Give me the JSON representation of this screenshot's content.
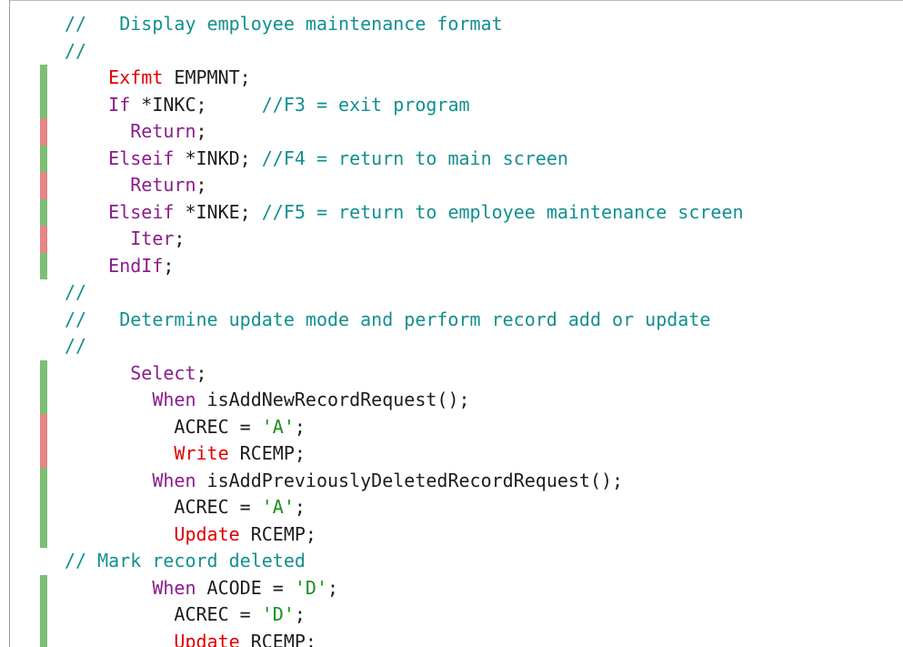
{
  "lines": [
    {
      "marker": "none",
      "tokens": [
        {
          "t": "cm",
          "v": "//   Display employee maintenance format"
        }
      ]
    },
    {
      "marker": "none",
      "tokens": [
        {
          "t": "cm",
          "v": "//"
        }
      ]
    },
    {
      "marker": "green",
      "tokens": [
        {
          "t": "pl",
          "v": "    "
        },
        {
          "t": "op",
          "v": "Exfmt"
        },
        {
          "t": "pl",
          "v": " EMPMNT;"
        }
      ]
    },
    {
      "marker": "green",
      "tokens": [
        {
          "t": "pl",
          "v": "    "
        },
        {
          "t": "kw",
          "v": "If"
        },
        {
          "t": "pl",
          "v": " *INKC;     "
        },
        {
          "t": "cm",
          "v": "//F3 = exit program"
        }
      ]
    },
    {
      "marker": "red",
      "tokens": [
        {
          "t": "pl",
          "v": "      "
        },
        {
          "t": "kw",
          "v": "Return"
        },
        {
          "t": "pl",
          "v": ";"
        }
      ]
    },
    {
      "marker": "green",
      "tokens": [
        {
          "t": "pl",
          "v": "    "
        },
        {
          "t": "kw",
          "v": "Elseif"
        },
        {
          "t": "pl",
          "v": " *INKD; "
        },
        {
          "t": "cm",
          "v": "//F4 = return to main screen"
        }
      ]
    },
    {
      "marker": "red",
      "tokens": [
        {
          "t": "pl",
          "v": "      "
        },
        {
          "t": "kw",
          "v": "Return"
        },
        {
          "t": "pl",
          "v": ";"
        }
      ]
    },
    {
      "marker": "green",
      "tokens": [
        {
          "t": "pl",
          "v": "    "
        },
        {
          "t": "kw",
          "v": "Elseif"
        },
        {
          "t": "pl",
          "v": " *INKE; "
        },
        {
          "t": "cm",
          "v": "//F5 = return to employee maintenance screen"
        }
      ]
    },
    {
      "marker": "red",
      "tokens": [
        {
          "t": "pl",
          "v": "      "
        },
        {
          "t": "kw",
          "v": "Iter"
        },
        {
          "t": "pl",
          "v": ";"
        }
      ]
    },
    {
      "marker": "green",
      "tokens": [
        {
          "t": "pl",
          "v": "    "
        },
        {
          "t": "kw",
          "v": "EndIf"
        },
        {
          "t": "pl",
          "v": ";"
        }
      ]
    },
    {
      "marker": "none",
      "tokens": [
        {
          "t": "cm",
          "v": "//"
        }
      ]
    },
    {
      "marker": "none",
      "tokens": [
        {
          "t": "cm",
          "v": "//   Determine update mode and perform record add or update"
        }
      ]
    },
    {
      "marker": "none",
      "tokens": [
        {
          "t": "cm",
          "v": "//"
        }
      ]
    },
    {
      "marker": "green",
      "tokens": [
        {
          "t": "pl",
          "v": "      "
        },
        {
          "t": "kw",
          "v": "Select"
        },
        {
          "t": "pl",
          "v": ";"
        }
      ]
    },
    {
      "marker": "green",
      "tokens": [
        {
          "t": "pl",
          "v": "        "
        },
        {
          "t": "kw",
          "v": "When"
        },
        {
          "t": "pl",
          "v": " isAddNewRecordRequest();"
        }
      ]
    },
    {
      "marker": "red",
      "tokens": [
        {
          "t": "pl",
          "v": "          ACREC = "
        },
        {
          "t": "st",
          "v": "'A'"
        },
        {
          "t": "pl",
          "v": ";"
        }
      ]
    },
    {
      "marker": "red",
      "tokens": [
        {
          "t": "pl",
          "v": "          "
        },
        {
          "t": "op",
          "v": "Write"
        },
        {
          "t": "pl",
          "v": " RCEMP;"
        }
      ]
    },
    {
      "marker": "green",
      "tokens": [
        {
          "t": "pl",
          "v": "        "
        },
        {
          "t": "kw",
          "v": "When"
        },
        {
          "t": "pl",
          "v": " isAddPreviouslyDeletedRecordRequest();"
        }
      ]
    },
    {
      "marker": "green",
      "tokens": [
        {
          "t": "pl",
          "v": "          ACREC = "
        },
        {
          "t": "st",
          "v": "'A'"
        },
        {
          "t": "pl",
          "v": ";"
        }
      ]
    },
    {
      "marker": "green",
      "tokens": [
        {
          "t": "pl",
          "v": "          "
        },
        {
          "t": "op",
          "v": "Update"
        },
        {
          "t": "pl",
          "v": " RCEMP;"
        }
      ]
    },
    {
      "marker": "none",
      "tokens": [
        {
          "t": "cm",
          "v": "// Mark record deleted"
        }
      ]
    },
    {
      "marker": "green",
      "tokens": [
        {
          "t": "pl",
          "v": "        "
        },
        {
          "t": "kw",
          "v": "When"
        },
        {
          "t": "pl",
          "v": " ACODE = "
        },
        {
          "t": "st",
          "v": "'D'"
        },
        {
          "t": "pl",
          "v": ";"
        }
      ]
    },
    {
      "marker": "green",
      "tokens": [
        {
          "t": "pl",
          "v": "          ACREC = "
        },
        {
          "t": "st",
          "v": "'D'"
        },
        {
          "t": "pl",
          "v": ";"
        }
      ]
    },
    {
      "marker": "green",
      "tokens": [
        {
          "t": "pl",
          "v": "          "
        },
        {
          "t": "op",
          "v": "Update"
        },
        {
          "t": "pl",
          "v": " RCEMP;"
        }
      ]
    }
  ],
  "colors": {
    "keyword": "#8b1c8b",
    "opcode": "#e00000",
    "comment": "#138f8f",
    "string": "#1a8f1a",
    "plain": "#1c1c1c",
    "marker_green": "#7cbf75",
    "marker_red": "#e58585"
  }
}
